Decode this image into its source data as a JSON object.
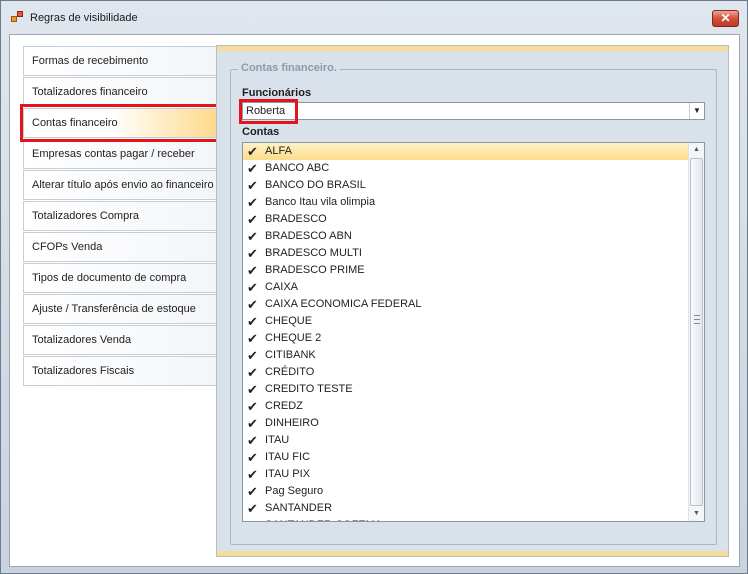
{
  "window": {
    "title": "Regras de visibilidade",
    "close_label": "✕"
  },
  "nav": {
    "items": [
      {
        "label": "Formas de recebimento"
      },
      {
        "label": "Totalizadores financeiro"
      },
      {
        "label": "Contas financeiro"
      },
      {
        "label": "Empresas contas pagar / receber"
      },
      {
        "label": "Alterar título após envio ao financeiro"
      },
      {
        "label": "Totalizadores Compra"
      },
      {
        "label": "CFOPs Venda"
      },
      {
        "label": "Tipos de documento de compra"
      },
      {
        "label": "Ajuste / Transferência de estoque"
      },
      {
        "label": "Totalizadores Venda"
      },
      {
        "label": "Totalizadores Fiscais"
      }
    ],
    "active_index": 2
  },
  "panel": {
    "group_title": "Contas financeiro.",
    "funcionarios_label": "Funcionários",
    "funcionario_selected": "Roberta",
    "contas_label": "Contas",
    "contas": [
      {
        "label": "ALFA",
        "checked": true
      },
      {
        "label": "BANCO ABC",
        "checked": true
      },
      {
        "label": "BANCO DO BRASIL",
        "checked": true
      },
      {
        "label": "Banco Itau vila olimpia",
        "checked": true
      },
      {
        "label": "BRADESCO",
        "checked": true
      },
      {
        "label": "BRADESCO ABN",
        "checked": true
      },
      {
        "label": "BRADESCO MULTI",
        "checked": true
      },
      {
        "label": "BRADESCO PRIME",
        "checked": true
      },
      {
        "label": "CAIXA",
        "checked": true
      },
      {
        "label": "CAIXA ECONOMICA FEDERAL",
        "checked": true
      },
      {
        "label": "CHEQUE",
        "checked": true
      },
      {
        "label": "CHEQUE 2",
        "checked": true
      },
      {
        "label": "CITIBANK",
        "checked": true
      },
      {
        "label": "CRÉDITO",
        "checked": true
      },
      {
        "label": "CREDITO TESTE",
        "checked": true
      },
      {
        "label": "CREDZ",
        "checked": true
      },
      {
        "label": "DINHEIRO",
        "checked": true
      },
      {
        "label": "ITAU",
        "checked": true
      },
      {
        "label": "ITAU FIC",
        "checked": true
      },
      {
        "label": "ITAU PIX",
        "checked": true
      },
      {
        "label": "Pag Seguro",
        "checked": true
      },
      {
        "label": "SANTANDER",
        "checked": true
      },
      {
        "label": "SANTANDER COFEMA",
        "checked": true
      }
    ]
  },
  "colors": {
    "highlight_red": "#e3141a",
    "selection_gold": "#fbdc8a",
    "panel_bg": "#d9e1ea",
    "accent_bar": "#f4dc9a"
  }
}
